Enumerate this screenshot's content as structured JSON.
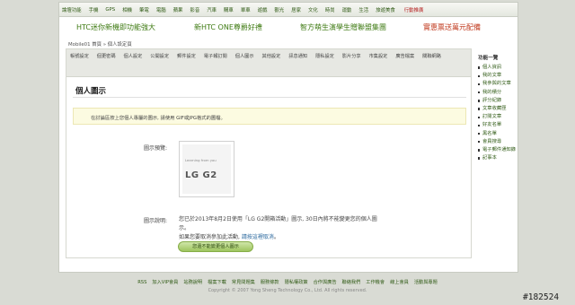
{
  "topnav": [
    "論壇功能",
    "手機",
    "GPS",
    "相機",
    "筆電",
    "電腦",
    "蘋果",
    "影音",
    "汽車",
    "購車",
    "單車",
    "遊戲",
    "觀光",
    "居家",
    "文化",
    "時尚",
    "運動",
    "生活",
    "旅遊美食"
  ],
  "topnav_hot": "行動推廣",
  "banner": [
    {
      "text": "HTC迷你新機即功能強大",
      "red": false
    },
    {
      "text": "新HTC ONE尊爵好禮",
      "red": false
    },
    {
      "text": "智方萌生演學生贈聯盟集團",
      "red": false
    },
    {
      "text": "實惠票送萬元配備",
      "red": true
    }
  ],
  "breadcrumb": "Mobile01 首頁 » 個人設定頁",
  "tabs": [
    "帳號設定",
    "個更密碼",
    "個人設定",
    "公開設定",
    "郵件設定",
    "電子報訂閱",
    "個人圖示",
    "其他設定",
    "訊息通知",
    "隱私設定",
    "影片分享",
    "市集設定",
    "廣告檔案",
    "關聯網路"
  ],
  "content": {
    "title": "個人圖示",
    "notice": "在討論區按上您個人專屬的圖示, 請使用 GIF或JPG格式的圖檔。",
    "preview_label": "圖示預覽:",
    "preview_learning": "Learning from you",
    "preview_logo": "LG G2",
    "desc_label": "圖示說明:",
    "desc_line1": "您已於2013年8月2日使用「LG G2開箱活動」圖示, 30日內將不能變更您的個人圖示。",
    "desc_line2": "如果您要取消參加此活動, ",
    "desc_link": "請按這裡取消",
    "desc_end": "。",
    "button": "您還不能變更個人圖示"
  },
  "sidebar": {
    "head": "功能一覽",
    "items": [
      "個人資訊",
      "我的文章",
      "我參與的文章",
      "我的積分",
      "評分紀錄",
      "文章收藏匣",
      "訂閱文章",
      "好友名單",
      "黑名單",
      "會員搜尋",
      "電子郵件通知錄",
      "記事本"
    ]
  },
  "footer": {
    "links": [
      "RSS",
      "加入VIP會員",
      "站務說明",
      "檔案下載",
      "常見問題集",
      "服務條款",
      "隱私權政策",
      "合作與廣告",
      "聯絡我們",
      "工作機會",
      "線上會員",
      "活動與專題"
    ],
    "copyright": "Copyright © 2007 Yong Sheng Technology Co., Ltd. All rights reserved."
  },
  "watermark": "#182524"
}
